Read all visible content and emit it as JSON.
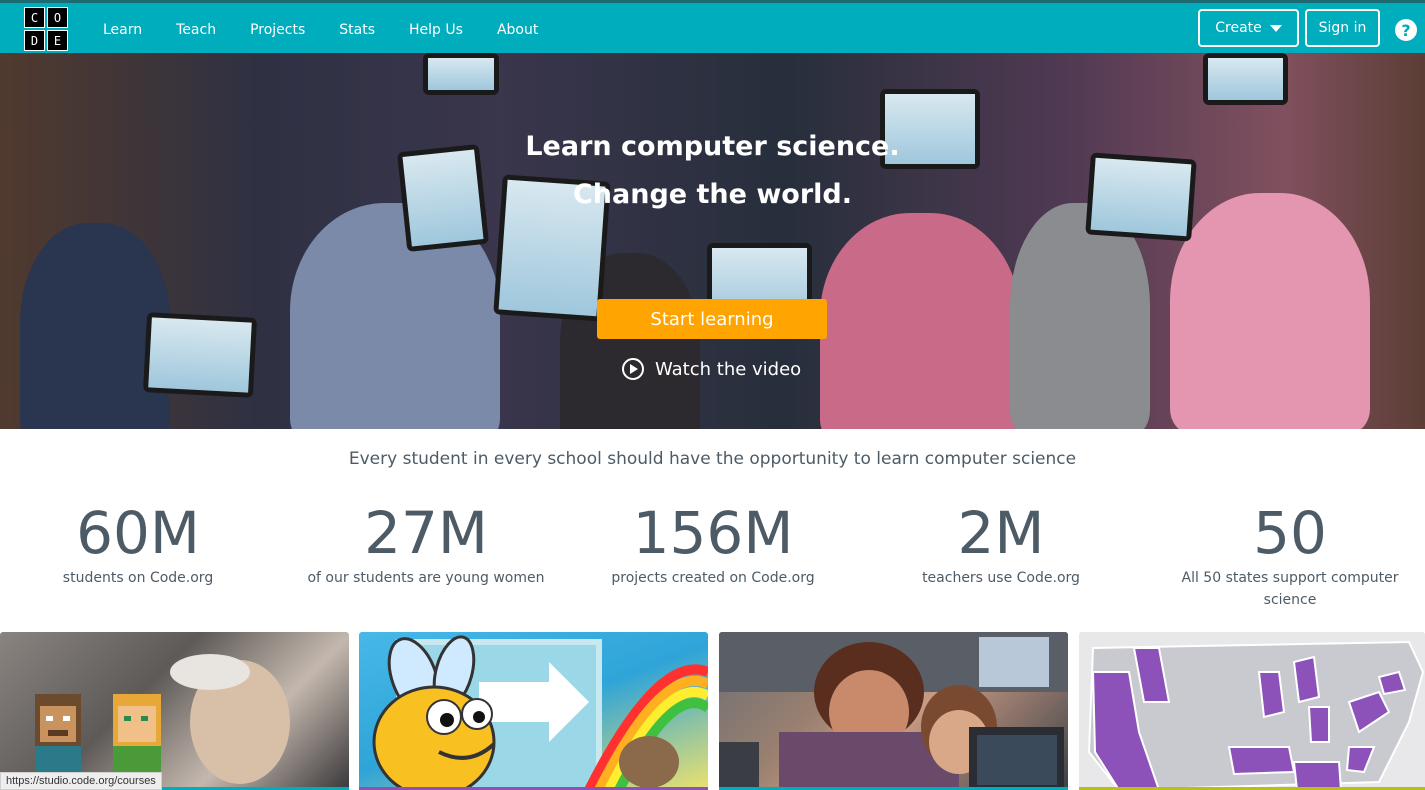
{
  "logo": {
    "letters": [
      "C",
      "O",
      "D",
      "E"
    ]
  },
  "nav": {
    "items": [
      "Learn",
      "Teach",
      "Projects",
      "Stats",
      "Help Us",
      "About"
    ],
    "create_label": "Create",
    "signin_label": "Sign in",
    "help_label": "?"
  },
  "hero": {
    "title_line1": "Learn computer science.",
    "title_line2": "Change the world.",
    "start_label": "Start learning",
    "watch_label": "Watch the video"
  },
  "tagline": "Every student in every school should have the opportunity to learn computer science",
  "stats": [
    {
      "num": "60M",
      "label": "students on Code.org"
    },
    {
      "num": "27M",
      "label": "of our students are young women"
    },
    {
      "num": "156M",
      "label": "projects created on Code.org"
    },
    {
      "num": "2M",
      "label": "teachers use Code.org"
    },
    {
      "num": "50",
      "label": "All 50 states support computer science"
    }
  ],
  "status_url": "https://studio.code.org/courses",
  "colors": {
    "brand": "#00adbc",
    "accent": "#ffa400",
    "purple": "#8c52ba",
    "map_state": "#8c52ba"
  }
}
